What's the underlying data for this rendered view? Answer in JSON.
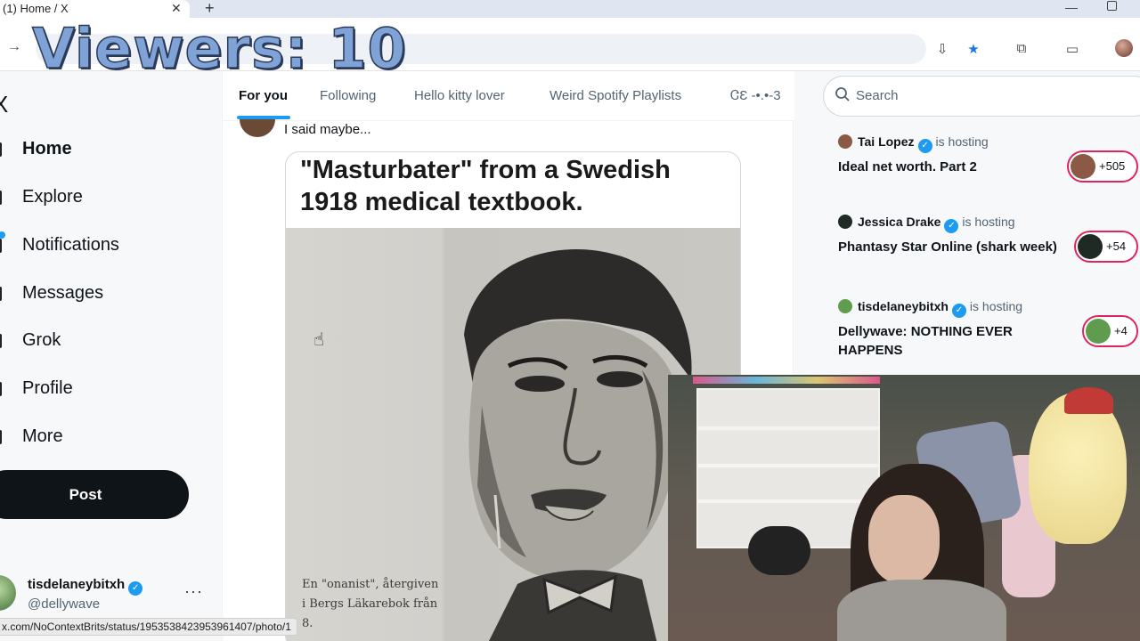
{
  "browser": {
    "tab_title": "(1) Home / X",
    "tab_close": "✕",
    "new_tab": "+",
    "status_url": "x.com/NoContextBrits/status/1953538423953961407/photo/1"
  },
  "overlay": {
    "viewers": "Viewers: 10"
  },
  "sidebar": {
    "logo": "X",
    "items": [
      {
        "label": "Home",
        "active": true,
        "badge": false
      },
      {
        "label": "Explore",
        "active": false,
        "badge": false
      },
      {
        "label": "Notifications",
        "active": false,
        "badge": true
      },
      {
        "label": "Messages",
        "active": false,
        "badge": false
      },
      {
        "label": "Grok",
        "active": false,
        "badge": false
      },
      {
        "label": "Profile",
        "active": false,
        "badge": false
      },
      {
        "label": "More",
        "active": false,
        "badge": false
      }
    ],
    "post_label": "Post",
    "account": {
      "name": "tisdelaneybitxh",
      "handle": "@dellywave",
      "more": "···"
    }
  },
  "timeline": {
    "tabs": [
      "For you",
      "Following",
      "Hello kitty lover",
      "Weird Spotify Playlists",
      "ᏣƐ -•.•-3"
    ],
    "active_tab": 0,
    "tweet_text": "I said maybe...",
    "media_caption": "\"Masturbater\" from a Swedish 1918 medical textbook.",
    "photo_caption_line1": "En \"onanist\", återgiven",
    "photo_caption_line2": "i Bergs Läkarebok från",
    "photo_caption_line3": "8."
  },
  "right": {
    "search_placeholder": "Search",
    "hosting_label": "is hosting",
    "spaces": [
      {
        "host": "Tai Lopez",
        "title": "Ideal  net worth. Part 2",
        "count": "+505",
        "ava_color": "#8a5a44"
      },
      {
        "host": "Jessica Drake",
        "title": "Phantasy Star Online (shark week)",
        "count": "+54",
        "ava_color": "#1f2a24"
      },
      {
        "host": "tisdelaneybitxh",
        "title": "Dellywave: NOTHING EVER HAPPENS",
        "count": "+4",
        "ava_color": "#5f9c4e"
      }
    ]
  },
  "colors": {
    "accent": "#1d9bf0",
    "live_ring": "#e0245e",
    "post_button": "#0f1419"
  }
}
